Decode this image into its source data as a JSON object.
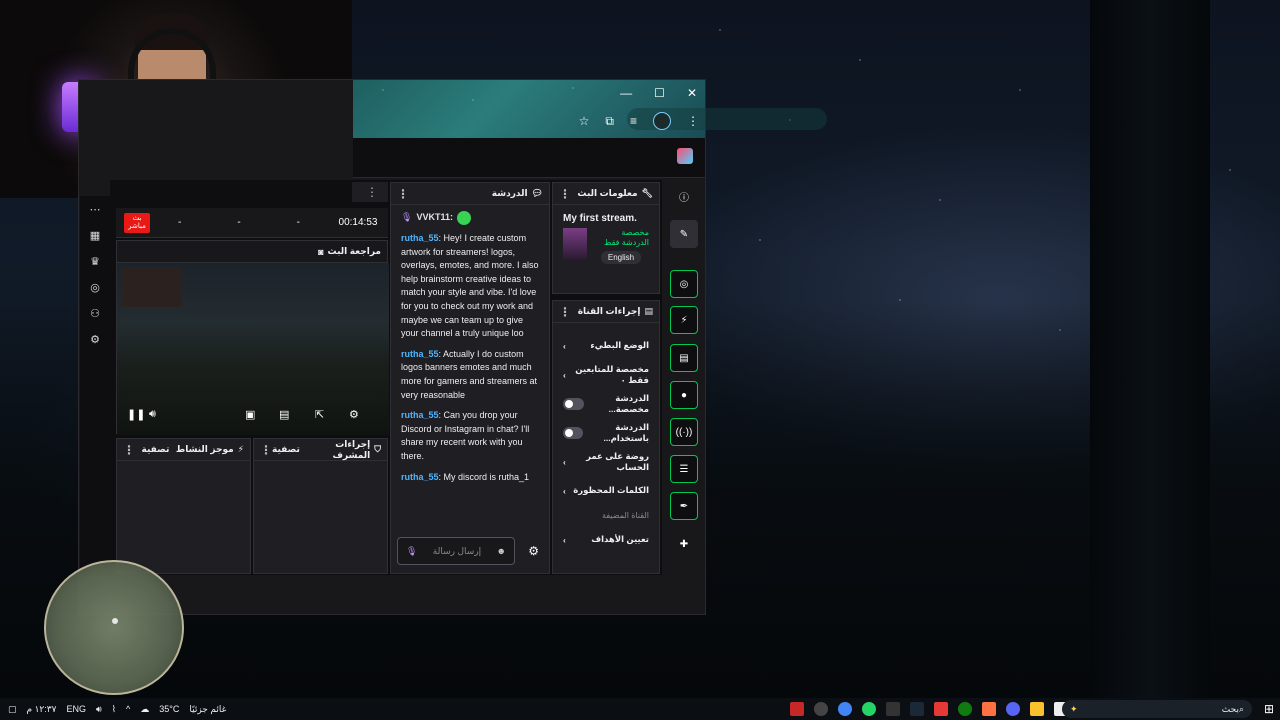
{
  "stats": {
    "live_badge": "بث مباشر",
    "cells": [
      "-",
      "-",
      "-"
    ],
    "timer": "00:14:53"
  },
  "preview": {
    "title": "مراجعة البث"
  },
  "panels": {
    "activity": {
      "title": "موجز النشاط",
      "filter": "تصفية"
    },
    "mod_actions": {
      "title": "إجراءات المشرف",
      "filter": "تصفية"
    }
  },
  "chat": {
    "title": "الدردشة",
    "first_user": "VVKT11:",
    "messages": [
      {
        "user": "rutha_55",
        "text": ": Hey! I create custom artwork for streamers! logos, overlays, emotes, and more. I also help brainstorm creative ideas to match your style and vibe. I'd love for you to check out my work and maybe we can team up to give your channel a truly unique loo"
      },
      {
        "user": "rutha_55",
        "text": ": Actually I do custom logos banners emotes and much more for gamers and streamers at very reasonable"
      },
      {
        "user": "rutha_55",
        "text": ": Can you drop your Discord or Instagram in chat? I'll share my recent work with you there."
      },
      {
        "user": "rutha_55",
        "text": ": My discord is rutha_1"
      }
    ],
    "input_placeholder": "إرسال رسالة"
  },
  "stream_info": {
    "title": "معلومات البث",
    "stream_title": "My first stream.",
    "category_line1": "مخصصة",
    "category_line2": "الدردشة فقط",
    "language": "English"
  },
  "channel_actions": {
    "title": "إجراءات القناة",
    "items": [
      {
        "label": "الوضع البطيء",
        "control": "chevron"
      },
      {
        "label": "مخصصة للمتابعين فقط ٠",
        "control": "chevron"
      },
      {
        "label": "الدردشة مخصصة...",
        "control": "toggle"
      },
      {
        "label": "الدردشة باستخدام...",
        "control": "toggle"
      },
      {
        "label": "روضة على عمر الحساب",
        "control": "chevron"
      },
      {
        "label": "الكلمات المحظورة",
        "control": "chevron"
      }
    ],
    "hint": "القناة المضيفة",
    "last_item": "تعيين الأهداف"
  },
  "taskbar": {
    "weather": "35°C",
    "weather_text": "غائم جزئيًا",
    "lang": "ENG",
    "time": "١٢:٣٧ م",
    "search_placeholder": "بحث"
  },
  "colors": {
    "accent_green": "#00c853",
    "live_red": "#e91916",
    "username_blue": "#4db5ff",
    "panel_bg": "#1f1f23"
  }
}
